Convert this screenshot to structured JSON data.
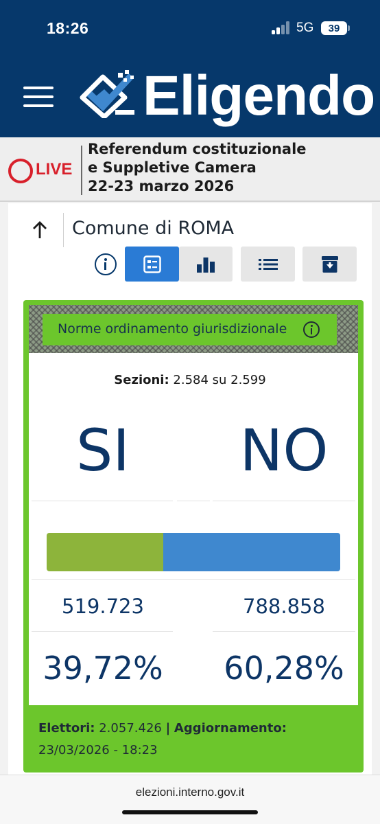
{
  "status_bar": {
    "time": "18:26",
    "network": "5G",
    "battery": "39"
  },
  "header": {
    "brand": "Eligendo",
    "icons": {
      "menu": "hamburger-menu-icon",
      "logo": "ballot-box-check-logo"
    }
  },
  "banner": {
    "live": "LIVE",
    "lines": [
      "Referendum costituzionale",
      "e Suppletive Camera",
      "22-23 marzo 2026"
    ]
  },
  "page": {
    "title": "Comune di ROMA",
    "view_buttons": [
      {
        "icon": "info-icon"
      },
      {
        "icon": "summary-grid-icon",
        "active": true
      },
      {
        "icon": "bar-chart-icon"
      },
      {
        "icon": "list-icon"
      },
      {
        "icon": "archive-download-icon"
      }
    ]
  },
  "result": {
    "quesito": "Norme ordinamento giurisdizionale",
    "sezioni_label": "Sezioni:",
    "sezioni_value": "2.584 su 2.599",
    "yes_label": "SI",
    "no_label": "NO",
    "yes_votes": "519.723",
    "no_votes": "788.858",
    "yes_pct": "39,72%",
    "no_pct": "60,28%",
    "yes_share": 0.3972,
    "elettori_label": "Elettori:",
    "elettori_value": "2.057.426",
    "separator": "|",
    "aggiornamento_label": "Aggiornamento:",
    "aggiornamento_value": "23/03/2026 - 18:23",
    "colors": {
      "yes": "#8db43b",
      "no": "#3f88cf",
      "frame": "#6cc62c"
    }
  },
  "browser": {
    "url": "elezioni.interno.gov.it"
  }
}
